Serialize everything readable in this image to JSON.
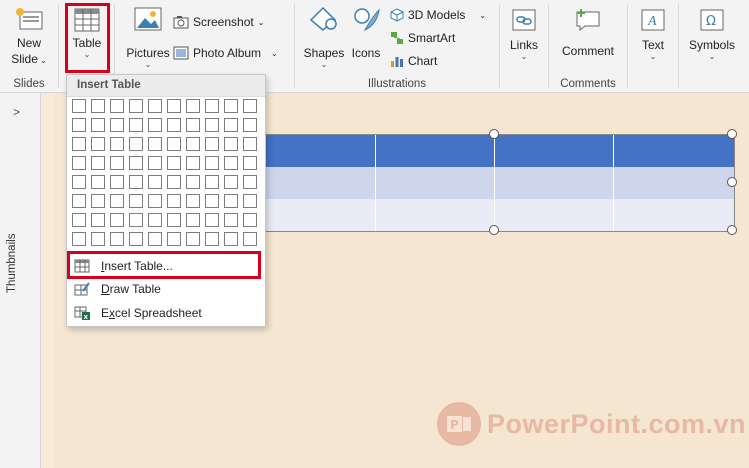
{
  "ribbon": {
    "slides_group": {
      "new_slide_label": "New",
      "new_slide_label2": "Slide",
      "group_label": "Slides"
    },
    "tables_group": {
      "table_label": "Table"
    },
    "images_group": {
      "pictures_label": "Pictures",
      "screenshot_label": "Screenshot",
      "photo_album_label": "Photo Album"
    },
    "illustrations_group": {
      "shapes_label": "Shapes",
      "icons_label": "Icons",
      "models_label": "3D Models",
      "smartart_label": "SmartArt",
      "chart_label": "Chart",
      "group_label": "Illustrations"
    },
    "links_group": {
      "links_label": "Links"
    },
    "comments_group": {
      "comment_label": "Comment",
      "group_label": "Comments"
    },
    "text_group": {
      "text_label": "Text"
    },
    "symbols_group": {
      "symbols_label": "Symbols"
    }
  },
  "thumbnails": {
    "label": "Thumbnails",
    "toggle": ">"
  },
  "dropdown": {
    "header": "Insert Table",
    "grid": {
      "rows": 8,
      "cols": 10
    },
    "items": [
      {
        "label": "Insert Table...",
        "mnemonic": "I",
        "rest": "nsert Table...",
        "icon": "table-grid-icon"
      },
      {
        "label": "Draw Table",
        "mnemonic": "D",
        "rest": "raw Table",
        "icon": "pencil-table-icon"
      },
      {
        "label": "Excel Spreadsheet",
        "mnemonic": "x",
        "pre": "E",
        "rest": "cel Spreadsheet",
        "icon": "excel-icon"
      }
    ]
  },
  "watermark": {
    "text": "PowerPoint.com.vn"
  },
  "colors": {
    "highlight": "#d9001b",
    "table_header": "#4472c4",
    "table_band1": "#cfd5ea",
    "table_band2": "#e9ebf5"
  }
}
